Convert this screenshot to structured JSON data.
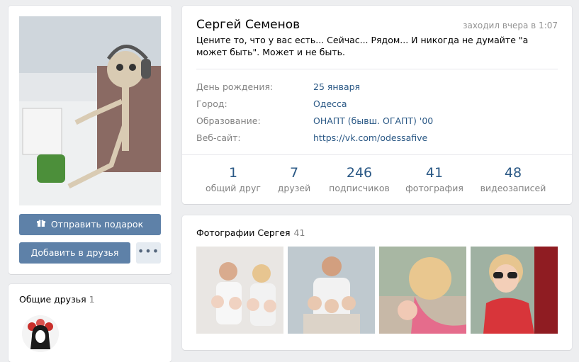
{
  "sidebar": {
    "gift_button": "Отправить подарок",
    "add_friend_button": "Добавить в друзья",
    "more_button": "•••",
    "common_friends_title": "Общие друзья",
    "common_friends_count": "1"
  },
  "profile": {
    "name": "Сергей Семенов",
    "last_seen": "заходил вчера в 1:07",
    "status": "Цените то, что у вас есть... Сейчас... Рядом... И никогда не думайте \"а может быть\". Может и не быть.",
    "info": [
      {
        "label": "День рождения:",
        "value": "25 января"
      },
      {
        "label": "Город:",
        "value": "Одесса"
      },
      {
        "label": "Образование:",
        "value": "ОНАПТ (бывш. ОГАПТ) '00"
      },
      {
        "label": "Веб-сайт:",
        "value": "https://vk.com/odessafive"
      }
    ],
    "counters": [
      {
        "num": "1",
        "label": "общий друг"
      },
      {
        "num": "7",
        "label": "друзей"
      },
      {
        "num": "246",
        "label": "подписчиков"
      },
      {
        "num": "41",
        "label": "фотография"
      },
      {
        "num": "48",
        "label": "видеозаписей"
      }
    ]
  },
  "photos": {
    "title": "Фотографии Сергея",
    "count": "41"
  },
  "colors": {
    "page_bg": "#edeef0",
    "accent_button": "#5e81a8",
    "link": "#2a5885",
    "muted": "#828282"
  },
  "icons": [
    "gift-icon"
  ]
}
